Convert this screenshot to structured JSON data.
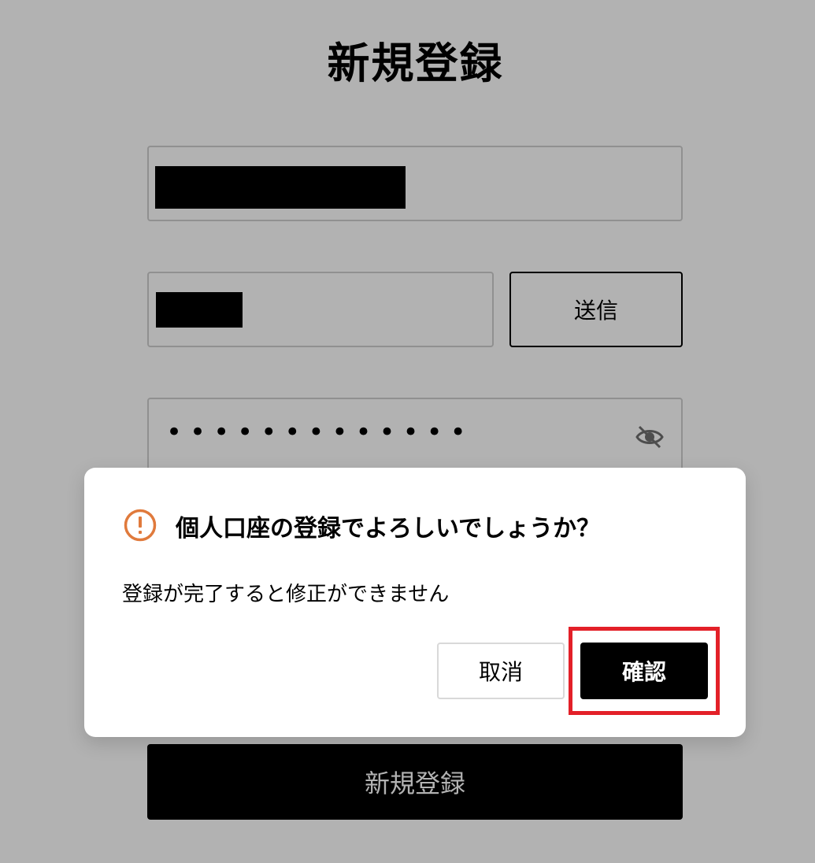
{
  "page": {
    "title": "新規登録",
    "send_label": "送信",
    "password_mask": "•••••••••••••",
    "submit_label": "新規登録"
  },
  "dialog": {
    "title": "個人口座の登録でよろしいでしょうか？",
    "message": "登録が完了すると修正ができません",
    "cancel_label": "取消",
    "confirm_label": "確認"
  },
  "colors": {
    "warning": "#e07a3c",
    "highlight": "#e32028",
    "overlay": "rgba(0,0,0,0.30)"
  },
  "icons": {
    "password_toggle": "eye-slash-icon",
    "warning": "exclamation-circle-icon"
  }
}
